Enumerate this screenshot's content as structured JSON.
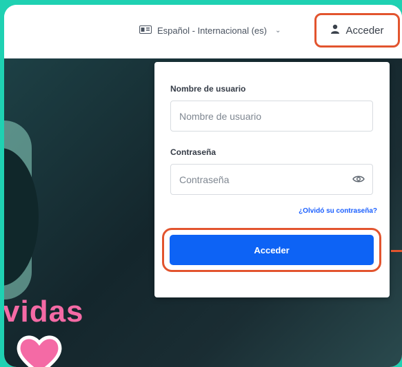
{
  "header": {
    "language_label": "Español - Internacional (es)",
    "login_label": "Acceder"
  },
  "hero": {
    "text": "vidas"
  },
  "form": {
    "username_label": "Nombre de usuario",
    "username_placeholder": "Nombre de usuario",
    "password_label": "Contraseña",
    "password_placeholder": "Contraseña",
    "forgot_link": "¿Olvidó su contraseña?",
    "submit_label": "Acceder"
  },
  "colors": {
    "accent": "#0d63f5",
    "highlight": "#e2542e",
    "hero_text": "#f46aa5",
    "background": "#1fd1b2"
  }
}
